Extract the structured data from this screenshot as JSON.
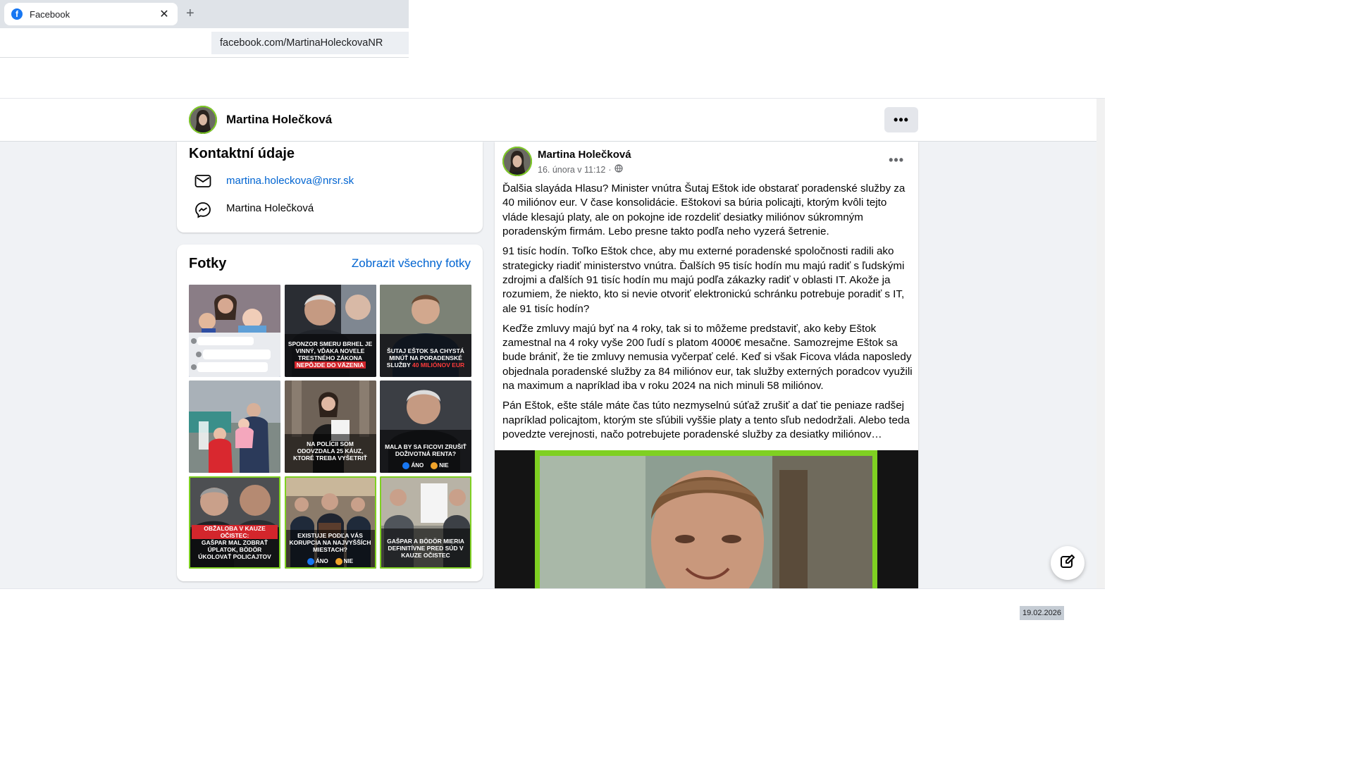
{
  "browser": {
    "tab_title": "Facebook",
    "favicon_letter": "f",
    "close_glyph": "✕",
    "new_tab_glyph": "+",
    "url": "facebook.com/MartinaHoleckovaNR"
  },
  "profile_bar": {
    "name": "Martina Holečková",
    "more_glyph": "•••"
  },
  "contact": {
    "title": "Kontaktní údaje",
    "email": "martina.holeckova@nrsr.sk",
    "messenger_name": "Martina Holečková"
  },
  "photos": {
    "title": "Fotky",
    "see_all": "Zobrazit všechny fotky",
    "captions": {
      "p2": "SPONZOR SMERU BRHEL JE VINNÝ, VĎAKA NOVELE TRESTNÉHO ZÁKONA",
      "p2_red": "NEPÔJDE DO VÄZENIA",
      "p3": "ŠUTAJ EŠTOK SA CHYSTÁ MINÚŤ NA PORADENSKÉ SLUŽBY",
      "p3_red": "40 MILIÓNOV EUR",
      "p5": "NA POLÍCII SOM ODOVZDALA 25 KÁUZ, KTORÉ TREBA VYŠETRIŤ",
      "p6": "MALA BY SA FICOVI ZRUŠIŤ DOŽIVOTNÁ RENTA?",
      "p7_red": "OBŽALOBA V KAUZE OČISTEC:",
      "p7": "GAŠPAR MAL ZOBRAŤ ÚPLATOK, BÖDÖR ÚKOLOVAŤ POLICAJTOV",
      "p8": "EXISTUJE PODĽA VÁS KORUPCIA NA NAJVYŠŠÍCH MIESTACH?",
      "p9": "GAŠPAR A BÖDÖR MIERIA DEFINITÍVNE PRED SÚD V KAUZE OČISTEC",
      "poll_yes": "ÁNO",
      "poll_no": "NIE"
    }
  },
  "post": {
    "author": "Martina Holečková",
    "timestamp": "16. února v 11:12",
    "separator": "·",
    "more_glyph": "•••",
    "paragraphs": [
      "Ďalšia slayáda Hlasu? Minister vnútra Šutaj Eštok ide obstarať poradenské služby za 40 miliónov eur. V čase konsolidácie. Eštokovi sa búria policajti, ktorým kvôli tejto vláde klesajú platy, ale on pokojne ide rozdeliť desiatky miliónov súkromným poradenským firmám. Lebo presne takto podľa neho vyzerá šetrenie.",
      "91 tisíc hodín. Toľko Eštok chce, aby mu externé poradenské spoločnosti radili ako strategicky riadiť ministerstvo vnútra. Ďalších 95 tisíc hodín mu majú radiť s ľudskými zdrojmi a ďalších 91 tisíc hodín mu majú podľa zákazky radiť v oblasti IT. Akože ja rozumiem, že niekto, kto si nevie otvoriť elektronickú schránku potrebuje poradiť s IT, ale 91 tisíc hodín?",
      "Keďže zmluvy majú byť na 4 roky, tak si to môžeme predstaviť, ako keby Eštok zamestnal na 4 roky vyše 200 ľudí s platom 4000€ mesačne. Samozrejme Eštok sa bude brániť, že tie zmluvy nemusia vyčerpať celé. Keď si však Ficova vláda naposledy objednala poradenské služby za 84 miliónov eur, tak služby externých poradcov využili na maximum a napríklad iba v roku 2024 na nich minuli 58 miliónov.",
      "Pán Eštok, ešte stále máte čas túto nezmyselnú súťaž zrušiť a dať tie peniaze radšej napríklad policajtom, ktorým ste sľúbili vyššie platy a tento sľub nedodržali. Alebo teda povedzte verejnosti, načo potrebujete poradenské služby za desiatky miliónov…"
    ]
  },
  "footer": {
    "date": "19.02.2026"
  },
  "colors": {
    "facebook_blue": "#1877f2",
    "link_blue": "#0064d1",
    "feed_bg": "#f0f2f5",
    "accent_green": "#7fd022",
    "red_label": "#d3262c"
  },
  "icons": [
    "facebook-favicon",
    "close-icon",
    "plus-icon",
    "more-icon",
    "mail-icon",
    "messenger-icon",
    "globe-icon",
    "compose-icon",
    "like-icon",
    "angry-icon"
  ]
}
